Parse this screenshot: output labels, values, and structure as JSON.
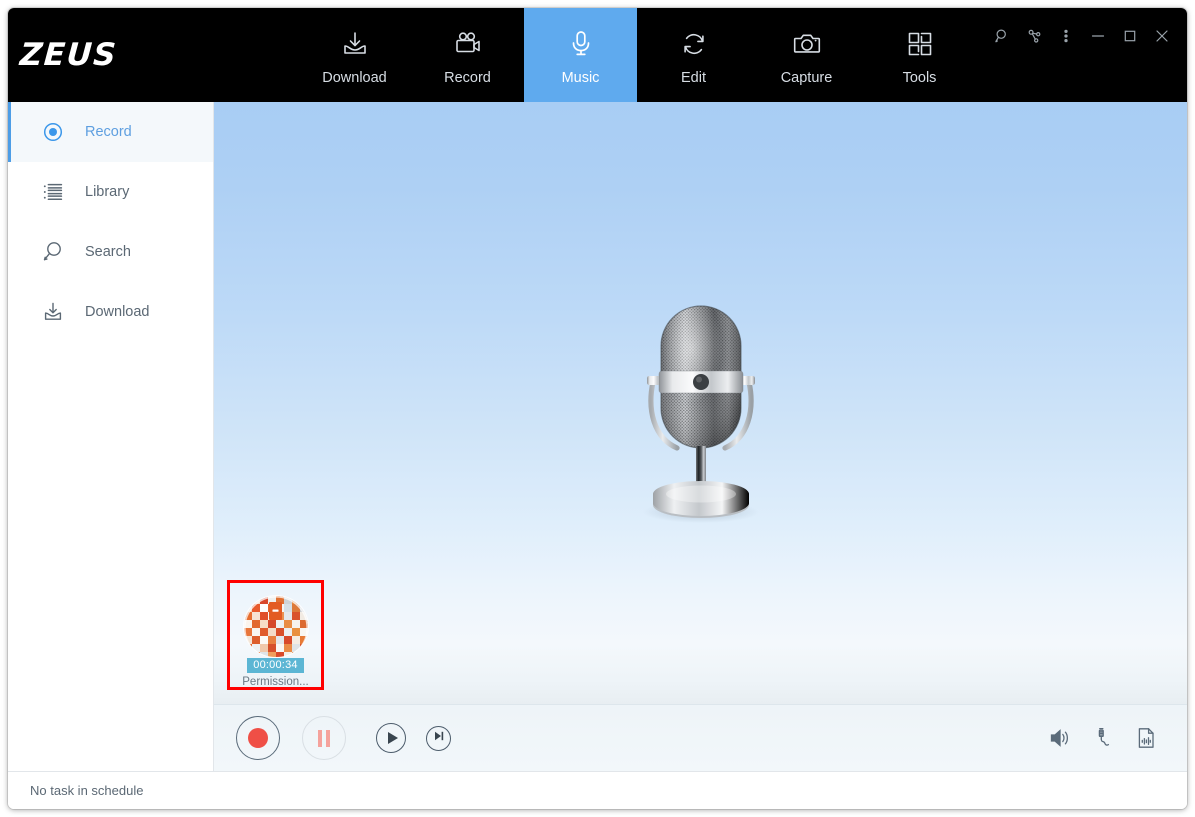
{
  "app": {
    "logo": "ZEUS"
  },
  "nav": {
    "tabs": [
      {
        "label": "Download",
        "icon": "download-icon",
        "active": false
      },
      {
        "label": "Record",
        "icon": "video-camera-icon",
        "active": false
      },
      {
        "label": "Music",
        "icon": "microphone-icon",
        "active": true
      },
      {
        "label": "Edit",
        "icon": "refresh-icon",
        "active": false
      },
      {
        "label": "Capture",
        "icon": "camera-icon",
        "active": false
      },
      {
        "label": "Tools",
        "icon": "grid-icon",
        "active": false
      }
    ],
    "active_color": "#5FAAEE"
  },
  "window_controls": [
    {
      "name": "search-icon"
    },
    {
      "name": "share-icon"
    },
    {
      "name": "more-vertical-icon"
    },
    {
      "name": "minimize-icon"
    },
    {
      "name": "maximize-icon"
    },
    {
      "name": "close-icon"
    }
  ],
  "sidebar": {
    "items": [
      {
        "label": "Record",
        "icon": "record-circle-icon",
        "active": true
      },
      {
        "label": "Library",
        "icon": "list-icon",
        "active": false
      },
      {
        "label": "Search",
        "icon": "magnifier-icon",
        "active": false
      },
      {
        "label": "Download",
        "icon": "download-icon",
        "active": false
      }
    ]
  },
  "stage": {
    "illustration": "vintage-microphone",
    "background_top": "#a8cdf4",
    "background_bottom": "#e8eef2"
  },
  "recordings": [
    {
      "duration": "00:00:34",
      "title": "Permission...",
      "artwork": "album-collage-circle",
      "selected": true,
      "selection_color": "#ff0000",
      "duration_badge_color": "#5cb6d4"
    }
  ],
  "toolbar": {
    "record_label": "Record",
    "pause_label": "Pause",
    "play_label": "Play",
    "next_label": "Next",
    "record_color": "#ef4f46",
    "pause_color": "#f5a29c",
    "right_icons": [
      {
        "name": "volume-icon"
      },
      {
        "name": "audio-jack-icon"
      },
      {
        "name": "audio-file-icon"
      }
    ]
  },
  "statusbar": {
    "text": "No task in schedule"
  }
}
